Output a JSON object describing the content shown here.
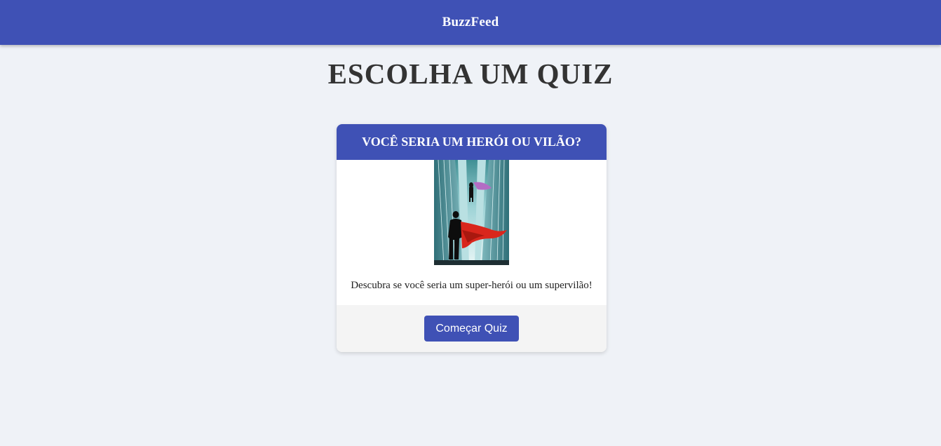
{
  "header": {
    "brand": "BuzzFeed"
  },
  "main": {
    "title": "ESCOLHA UM QUIZ"
  },
  "quiz_card": {
    "title": "VOCÊ SERIA UM HERÓI OU VILÃO?",
    "image": "superhero-skyline-illustration",
    "description": "Descubra se você seria um super-herói ou um supervilão!",
    "button_label": "Começar Quiz"
  },
  "colors": {
    "primary": "#3f51b5",
    "background": "#eff2f7",
    "card_footer": "#f4f4f4",
    "title_text": "#333333"
  }
}
